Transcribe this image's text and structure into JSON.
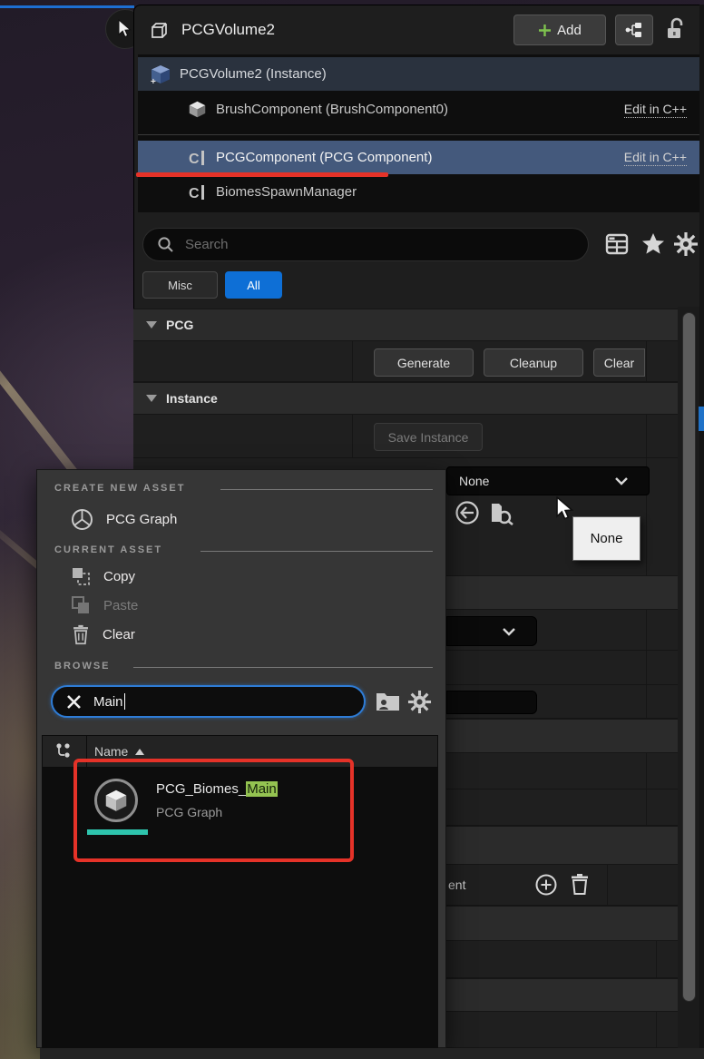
{
  "colors": {
    "accent_blue": "#0e6fd6",
    "selection_blue": "#44597c",
    "highlight_green": "#94c351",
    "annotation_red": "#e53228",
    "asset_type_teal": "#2ec4ad"
  },
  "header": {
    "title": "PCGVolume2",
    "add_label": "Add"
  },
  "component_tree": {
    "instance_label": "PCGVolume2 (Instance)",
    "brush_label": "BrushComponent (BrushComponent0)",
    "brush_edit": "Edit in C++",
    "pcg_label": "PCGComponent (PCG Component)",
    "pcg_edit": "Edit in C++",
    "biomes_label": "BiomesSpawnManager"
  },
  "toolbar": {
    "search_placeholder": "Search"
  },
  "filters": {
    "misc_label": "Misc",
    "all_label": "All"
  },
  "pcg_section": {
    "title": "PCG",
    "generate_label": "Generate",
    "cleanup_label": "Cleanup",
    "clear_label": "Clear"
  },
  "instance_section": {
    "title": "Instance",
    "save_label": "Save Instance"
  },
  "graph_row": {
    "value": "None"
  },
  "tooltip": {
    "text": "None"
  },
  "asset_picker": {
    "create_header": "CREATE NEW ASSET",
    "create_item_label": "PCG Graph",
    "current_header": "CURRENT ASSET",
    "copy_label": "Copy",
    "paste_label": "Paste",
    "clear_label": "Clear",
    "browse_header": "BROWSE",
    "search_value": "Main",
    "list_header": "Name",
    "asset_title_prefix": "PCG_Biomes_",
    "asset_title_highlight": "Main",
    "asset_subtitle": "PCG Graph"
  },
  "misc": {
    "array_row_fragment": "ent"
  }
}
